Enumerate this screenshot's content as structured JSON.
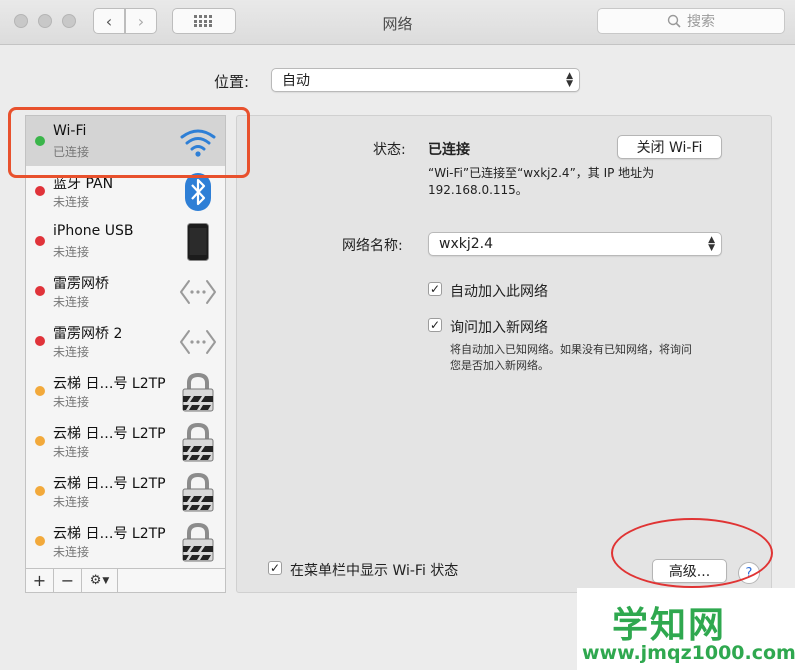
{
  "window": {
    "title": "网络",
    "search_placeholder": "搜索"
  },
  "location": {
    "label": "位置:",
    "value": "自动"
  },
  "sidebar": {
    "items": [
      {
        "name": "Wi-Fi",
        "status": "已连接",
        "dot": "#3ab54a",
        "icon": "wifi-icon"
      },
      {
        "name": "蓝牙 PAN",
        "status": "未连接",
        "dot": "#e0333a",
        "icon": "bluetooth-icon"
      },
      {
        "name": "iPhone USB",
        "status": "未连接",
        "dot": "#e0333a",
        "icon": "iphone-icon"
      },
      {
        "name": "雷雳网桥",
        "status": "未连接",
        "dot": "#e0333a",
        "icon": "bridge-icon"
      },
      {
        "name": "雷雳网桥 2",
        "status": "未连接",
        "dot": "#e0333a",
        "icon": "bridge-icon"
      },
      {
        "name": "云梯 日…号 L2TP",
        "status": "未连接",
        "dot": "#f2a93b",
        "icon": "lock-icon"
      },
      {
        "name": "云梯 日…号 L2TP",
        "status": "未连接",
        "dot": "#f2a93b",
        "icon": "lock-icon"
      },
      {
        "name": "云梯 日…号 L2TP",
        "status": "未连接",
        "dot": "#f2a93b",
        "icon": "lock-icon"
      },
      {
        "name": "云梯 日…号 L2TP",
        "status": "未连接",
        "dot": "#f2a93b",
        "icon": "lock-icon"
      }
    ],
    "buttons": {
      "add": "+",
      "remove": "−"
    }
  },
  "detail": {
    "status_label": "状态:",
    "status_value": "已连接",
    "turn_off_button": "关闭 Wi-Fi",
    "status_desc_line1": "“Wi-Fi”已连接至“wxkj2.4”，其 IP 地址为",
    "status_desc_line2": "192.168.0.115。",
    "network_name_label": "网络名称:",
    "network_name_value": "wxkj2.4",
    "auto_join_label": "自动加入此网络",
    "ask_join_label": "询问加入新网络",
    "ask_join_desc_line1": "将自动加入已知网络。如果没有已知网络，将询问",
    "ask_join_desc_line2": "您是否加入新网络。",
    "show_in_menubar_label": "在菜单栏中显示 Wi-Fi 状态",
    "advanced_button": "高级...",
    "help_button": "?"
  },
  "watermark": {
    "title": "学知网",
    "url": "www.jmqz1000.com"
  },
  "colors": {
    "highlight": "#e8512d",
    "watermark": "#2fa84f",
    "wifi_blue": "#2e7fd6"
  }
}
